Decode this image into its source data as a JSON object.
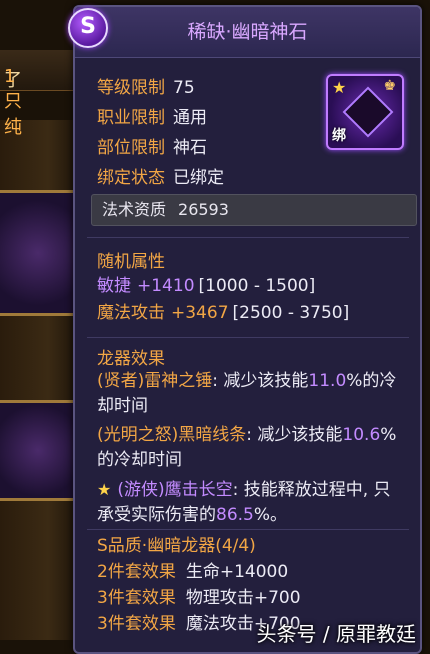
{
  "background": {
    "strip_text": "了",
    "strip_highlight": "1只纯"
  },
  "tooltip": {
    "grade_badge": "S",
    "title": "稀缺·幽暗神石",
    "attrs": [
      {
        "k": "等级限制",
        "v": "75"
      },
      {
        "k": "职业限制",
        "v": "通用"
      },
      {
        "k": "部位限制",
        "v": "神石"
      },
      {
        "k": "绑定状态",
        "v": "已绑定"
      }
    ],
    "icon": {
      "bind_label": "绑"
    },
    "magic": {
      "k": "法术资质",
      "v": "26593"
    },
    "random": {
      "title": "随机属性",
      "stats": [
        {
          "k": "敏捷",
          "v": "+1410",
          "range": "[1000 - 1500]"
        },
        {
          "k": "魔法攻击",
          "v": "+3467",
          "range": "[2500 - 3750]"
        }
      ]
    },
    "dragon": {
      "title": "龙器效果",
      "e1_name": "(贤者)雷神之锤",
      "e1_text_a": ": 减少该技能",
      "e1_pct": "11.0",
      "e1_text_b": "%的冷却时间",
      "e2_name": "(光明之怒)黑暗线条",
      "e2_text_a": ": 减少该技能",
      "e2_pct": "10.6",
      "e2_text_b": "%的冷却时间",
      "e3_name": "(游侠)鹰击长空",
      "e3_text_a": ": 技能释放过程中, 只承受实际伤害的",
      "e3_pct": "86.5",
      "e3_text_b": "%。"
    },
    "set": {
      "title": "S品质·幽暗龙器(4/4)",
      "items": [
        {
          "k": "2件套效果",
          "v": "生命+14000"
        },
        {
          "k": "3件套效果",
          "v": "物理攻击+700"
        },
        {
          "k": "3件套效果",
          "v": "魔法攻击+700"
        }
      ]
    }
  },
  "watermark": "头条号 / 原罪教廷",
  "colors": {
    "panel_bg": "#231f3d",
    "label_orange": "#f2a645",
    "accent_purple": "#c38bff",
    "title_purple": "#d9a8ff"
  }
}
